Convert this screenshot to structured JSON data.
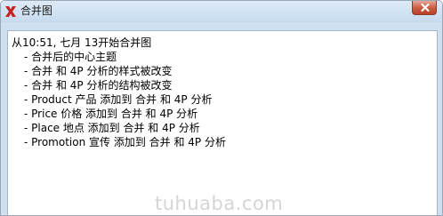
{
  "window": {
    "title": "合并图",
    "icon": "xmind-x-icon",
    "close_icon": "close-icon",
    "colors": {
      "frame": "#cfe0f1",
      "close_button": "#c75a42",
      "app_icon": "#c8201f"
    }
  },
  "log": {
    "header": "从10:51, 七月 13开始合并图",
    "items": [
      "- 合并后的中心主题",
      "- 合并 和 4P 分析的样式被改变",
      "- 合并 和 4P 分析的结构被改变",
      "- Product 产品 添加到 合并 和 4P 分析",
      "- Price 价格 添加到 合并 和 4P 分析",
      "- Place 地点 添加到 合并 和 4P 分析",
      "- Promotion 宣传 添加到 合并 和 4P 分析"
    ]
  },
  "watermark": "tuhuaba.com"
}
